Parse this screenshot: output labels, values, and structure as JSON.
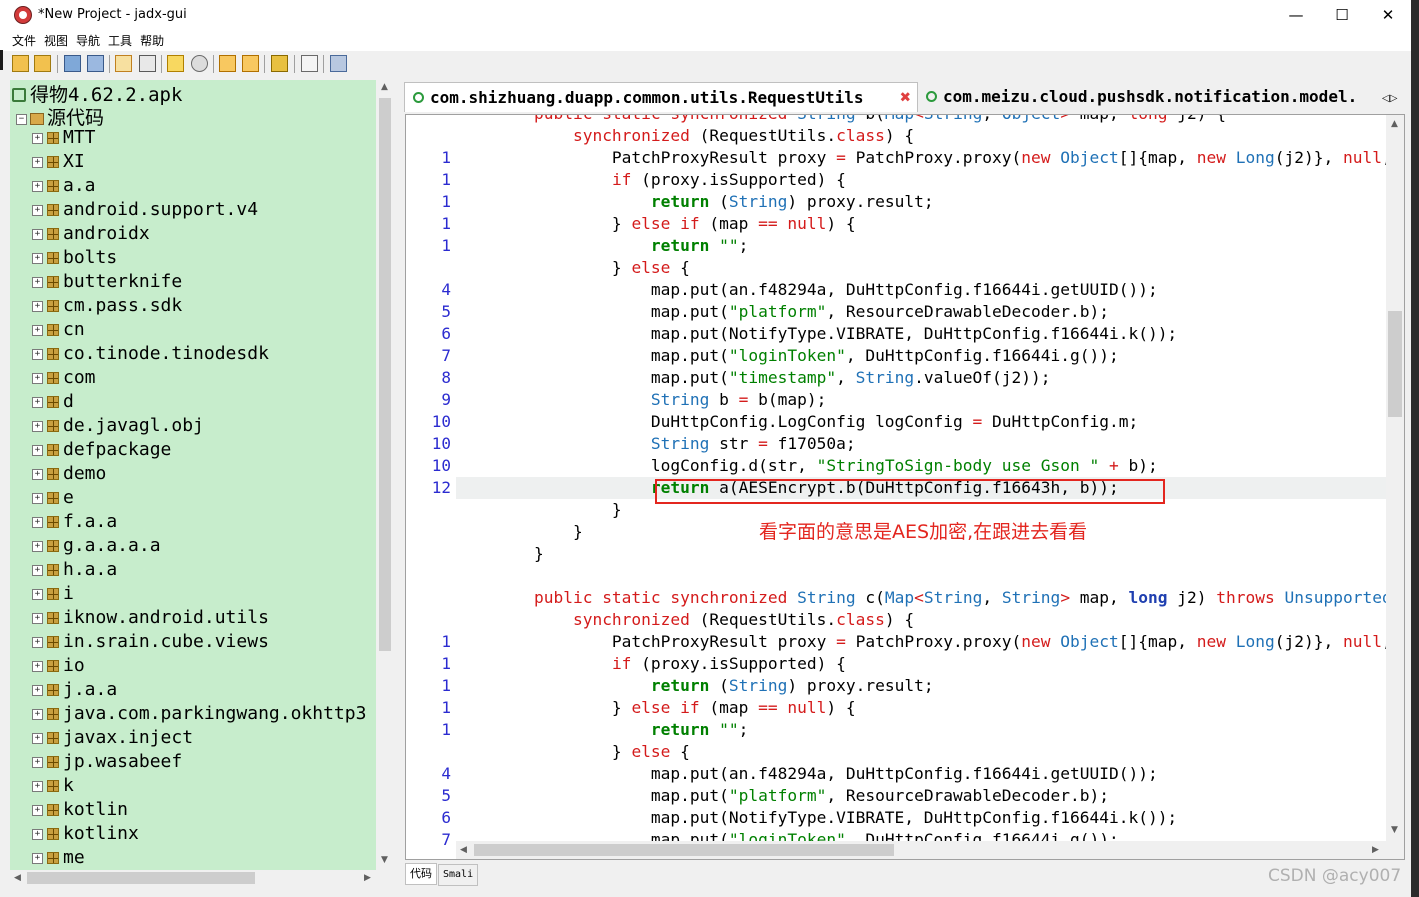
{
  "window": {
    "title": "*New Project - jadx-gui",
    "minimize": "—",
    "maximize": "☐",
    "close": "✕"
  },
  "menu": [
    "文件",
    "视图",
    "导航",
    "工具",
    "帮助"
  ],
  "tree": {
    "root": "得物4.62.2.apk",
    "source": "源代码",
    "packages": [
      "MTT",
      "XI",
      "a.a",
      "android.support.v4",
      "androidx",
      "bolts",
      "butterknife",
      "cm.pass.sdk",
      "cn",
      "co.tinode.tinodesdk",
      "com",
      "d",
      "de.javagl.obj",
      "defpackage",
      "demo",
      "e",
      "f.a.a",
      "g.a.a.a.a",
      "h.a.a",
      "i",
      "iknow.android.utils",
      "in.srain.cube.views",
      "io",
      "j.a.a",
      "java.com.parkingwang.okhttp3",
      "javax.inject",
      "jp.wasabeef",
      "k",
      "kotlin",
      "kotlinx",
      "me"
    ]
  },
  "tabs": {
    "active": "com.shizhuang.duapp.common.utils.RequestUtils",
    "inactive": "com.meizu.cloud.pushsdk.notification.model.",
    "close": "✖",
    "nav": "◁▷"
  },
  "code": {
    "gutter": [
      "",
      "",
      "1",
      "1",
      "1",
      "1",
      "1",
      "",
      "4",
      "5",
      "6",
      "7",
      "8",
      "9",
      "10",
      "10",
      "10",
      "12",
      "",
      "",
      "",
      "",
      "",
      "",
      "1",
      "1",
      "1",
      "1",
      "1",
      "",
      "4",
      "5",
      "6",
      "7"
    ],
    "annotation": "看字面的意思是AES加密,在跟进去看看"
  },
  "bottom_tabs": [
    "代码",
    "Smali"
  ],
  "watermark": "CSDN @acy007",
  "colors": {
    "tree_bg": "#c7edcc",
    "keyword": "#d41b1b",
    "type": "#1f71b6",
    "string": "#008000",
    "line_number": "#2b2bd0",
    "highlight_box": "#e3261f"
  }
}
